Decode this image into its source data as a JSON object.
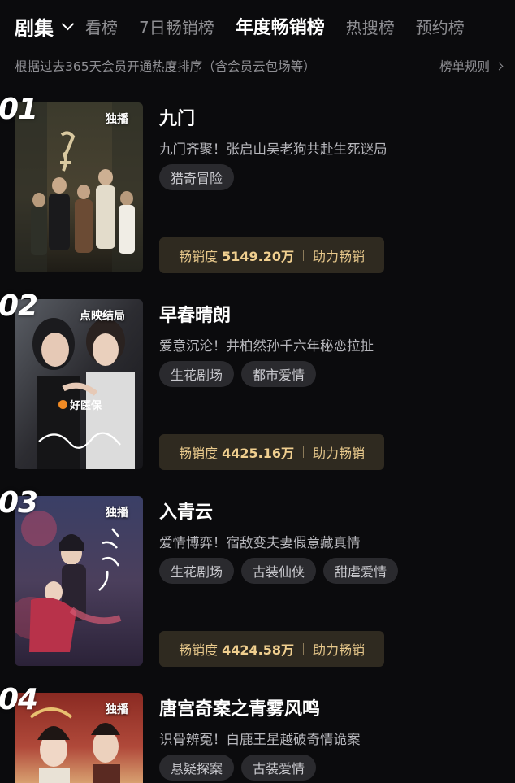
{
  "nav": {
    "main": "剧集",
    "tabs": [
      "看榜",
      "7日畅销榜",
      "年度畅销榜",
      "热搜榜",
      "预约榜"
    ],
    "active_index": 2
  },
  "subhead": {
    "text": "根据过去365天会员开通热度排序（含会员云包场等）",
    "rules_label": "榜单规则"
  },
  "items": [
    {
      "rank": "01",
      "badge": "独播",
      "title": "九门",
      "desc": "九门齐聚！张启山吴老狗共赴生死谜局",
      "tags": [
        "猎奇冒险"
      ],
      "sales_label": "畅销度",
      "sales_value": "5149.20万",
      "boost_label": "助力畅销"
    },
    {
      "rank": "02",
      "badge": "点映结局",
      "title": "早春晴朗",
      "desc": "爱意沉沦！井柏然孙千六年秘恋拉扯",
      "tags": [
        "生花剧场",
        "都市爱情"
      ],
      "sales_label": "畅销度",
      "sales_value": "4425.16万",
      "boost_label": "助力畅销",
      "poster_logo": "好医保"
    },
    {
      "rank": "03",
      "badge": "独播",
      "title": "入青云",
      "desc": "爱情博弈！宿敌变夫妻假意藏真情",
      "tags": [
        "生花剧场",
        "古装仙侠",
        "甜虐爱情"
      ],
      "sales_label": "畅销度",
      "sales_value": "4424.58万",
      "boost_label": "助力畅销"
    },
    {
      "rank": "04",
      "badge": "独播",
      "title": "唐宫奇案之青雾风鸣",
      "desc": "识骨辨冤！白鹿王星越破奇情诡案",
      "tags": [
        "悬疑探案",
        "古装爱情"
      ]
    }
  ],
  "colors": {
    "background": "#0b0b0d",
    "accent_gold": "#e8c98c",
    "tag_bg": "#2a2a2e"
  }
}
